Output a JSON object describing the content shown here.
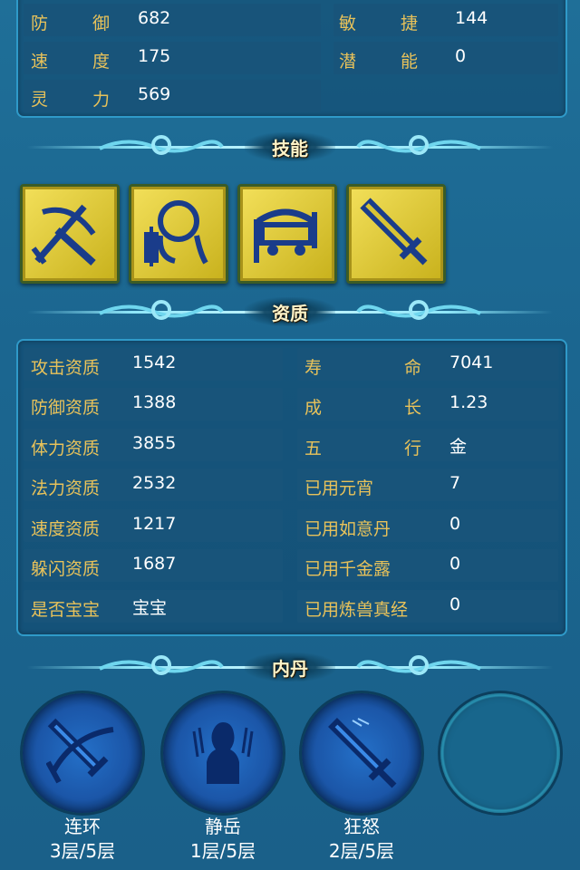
{
  "top_stats": [
    {
      "label_chars": [
        "防",
        "御"
      ],
      "value": "682"
    },
    {
      "label_chars": [
        "敏",
        "捷"
      ],
      "value": "144"
    },
    {
      "label_chars": [
        "速",
        "度"
      ],
      "value": "175"
    },
    {
      "label_chars": [
        "潜",
        "能"
      ],
      "value": "0"
    },
    {
      "label_chars": [
        "灵",
        "力"
      ],
      "value": "569"
    }
  ],
  "sections": {
    "skills_title": "技能",
    "aptitude_title": "资质",
    "neidan_title": "内丹"
  },
  "skills": [
    {
      "icon": "crossed-swords-icon"
    },
    {
      "icon": "warrior-shield-icon"
    },
    {
      "icon": "chariot-icon"
    },
    {
      "icon": "sword-icon"
    }
  ],
  "aptitude_left": [
    {
      "label": "攻击资质",
      "value": "1542"
    },
    {
      "label": "防御资质",
      "value": "1388"
    },
    {
      "label": "体力资质",
      "value": "3855"
    },
    {
      "label": "法力资质",
      "value": "2532"
    },
    {
      "label": "速度资质",
      "value": "1217"
    },
    {
      "label": "躲闪资质",
      "value": "1687"
    },
    {
      "label": "是否宝宝",
      "value": "宝宝"
    }
  ],
  "aptitude_right": [
    {
      "label_chars": [
        "寿",
        "命"
      ],
      "value": "7041"
    },
    {
      "label_chars": [
        "成",
        "长"
      ],
      "value": "1.23"
    },
    {
      "label_chars": [
        "五",
        "行"
      ],
      "value": "金"
    },
    {
      "label": "已用元宵",
      "value": "7"
    },
    {
      "label": "已用如意丹",
      "value": "0"
    },
    {
      "label": "已用千金露",
      "value": "0"
    },
    {
      "label": "已用炼兽真经",
      "value": "0"
    }
  ],
  "neidan": [
    {
      "name": "连环",
      "level": "3层/5层",
      "icon": "chain-swords-icon"
    },
    {
      "name": "静岳",
      "level": "1层/5层",
      "icon": "silhouette-icon"
    },
    {
      "name": "狂怒",
      "level": "2层/5层",
      "icon": "fury-sword-icon"
    }
  ],
  "colors": {
    "label": "#e8c25a",
    "value": "#ffffff",
    "cell": "#18547a",
    "skill_bg": "#e8d43c"
  }
}
